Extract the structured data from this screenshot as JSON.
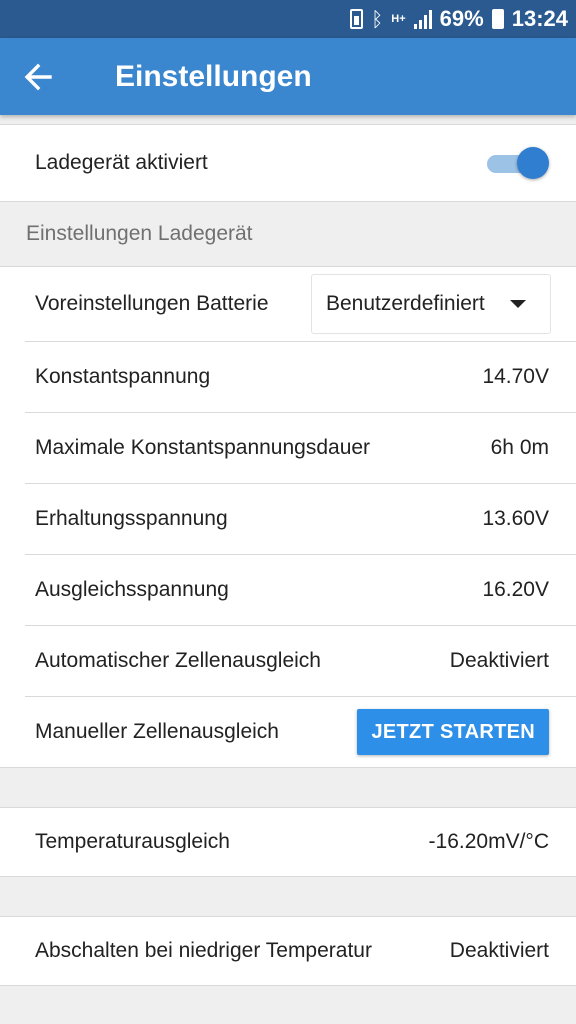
{
  "status_bar": {
    "battery_percent": "69%",
    "time": "13:24",
    "network_label": "H+"
  },
  "app_bar": {
    "title": "Einstellungen",
    "color": "#3a86cf"
  },
  "charger_toggle": {
    "label": "Ladegerät aktiviert",
    "enabled": true
  },
  "section_charger": {
    "header": "Einstellungen Ladegerät",
    "battery_preset": {
      "label": "Voreinstellungen Batterie",
      "selected": "Benutzerdefiniert"
    },
    "rows": [
      {
        "label": "Konstantspannung",
        "value": "14.70V"
      },
      {
        "label": "Maximale Konstantspannungsdauer",
        "value": "6h 0m"
      },
      {
        "label": "Erhaltungsspannung",
        "value": "13.60V"
      },
      {
        "label": "Ausgleichsspannung",
        "value": "16.20V"
      },
      {
        "label": "Automatischer Zellenausgleich",
        "value": "Deaktiviert"
      }
    ],
    "manual_equalization": {
      "label": "Manueller Zellenausgleich",
      "button_label": "JETZT STARTEN"
    }
  },
  "temperature_compensation": {
    "label": "Temperaturausgleich",
    "value": "-16.20mV/°C"
  },
  "low_temp_cutoff": {
    "label": "Abschalten bei niedriger Temperatur",
    "value": "Deaktiviert"
  }
}
